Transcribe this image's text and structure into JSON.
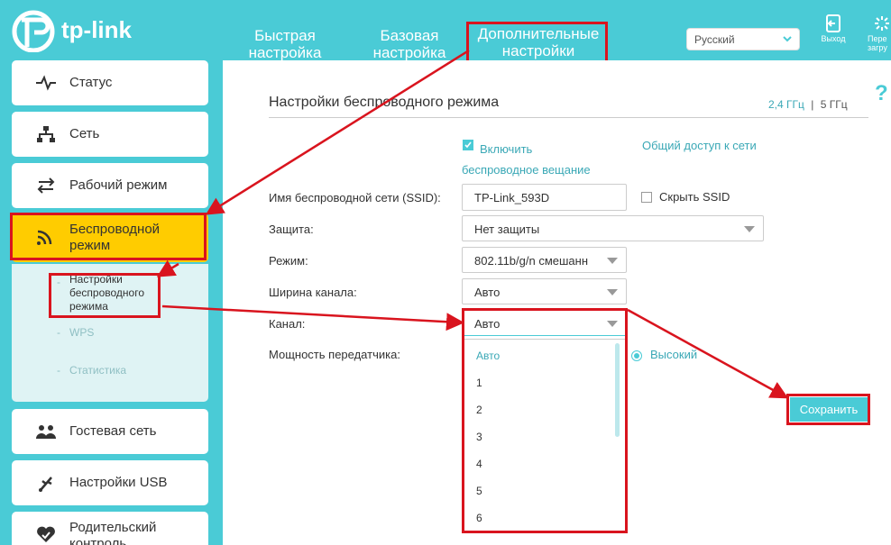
{
  "header": {
    "logo_text": "tp-link",
    "tabs": [
      {
        "label": "Быстрая настройка"
      },
      {
        "label": "Базовая настройка"
      },
      {
        "label": "Дополнительные настройки"
      }
    ],
    "language": "Русский",
    "logout_label": "Выход",
    "reboot_label_partial": "Пере загру"
  },
  "sidebar": {
    "items": [
      {
        "label": "Статус",
        "icon": "pulse-icon"
      },
      {
        "label": "Сеть",
        "icon": "network-icon"
      },
      {
        "label": "Рабочий режим",
        "icon": "switch-mode-icon"
      },
      {
        "label": "Беспроводной режим",
        "icon": "wireless-icon"
      },
      {
        "label": "Гостевая сеть",
        "icon": "guests-icon"
      },
      {
        "label": "Настройки USB",
        "icon": "usb-icon"
      },
      {
        "label": "Родительский контроль",
        "icon": "heart-icon"
      }
    ],
    "submenu": [
      {
        "label": "Настройки беспроводного режима"
      },
      {
        "label": "WPS"
      },
      {
        "label": "Статистика"
      }
    ]
  },
  "main": {
    "title": "Настройки беспроводного режима",
    "band_24": "2,4 ГГц",
    "band_sep": "|",
    "band_5": "5 ГГц",
    "enable_label": "Включить беспроводное вещание",
    "share_label": "Общий доступ к сети",
    "ssid_label": "Имя беспроводной сети (SSID):",
    "ssid_value": "TP-Link_593D",
    "hide_ssid_label": "Скрыть SSID",
    "security_label": "Защита:",
    "security_value": "Нет защиты",
    "mode_label": "Режим:",
    "mode_value": "802.11b/g/n смешанн",
    "width_label": "Ширина канала:",
    "width_value": "Авто",
    "channel_label": "Канал:",
    "channel_value": "Авто",
    "power_label": "Мощность передатчика:",
    "power_value": "Высокий",
    "channel_options": [
      "Авто",
      "1",
      "2",
      "3",
      "4",
      "5",
      "6"
    ],
    "save_label": "Сохранить"
  },
  "colors": {
    "accent": "#4acbd6",
    "active_menu": "#ffcc00",
    "annotation": "#d9141e"
  }
}
